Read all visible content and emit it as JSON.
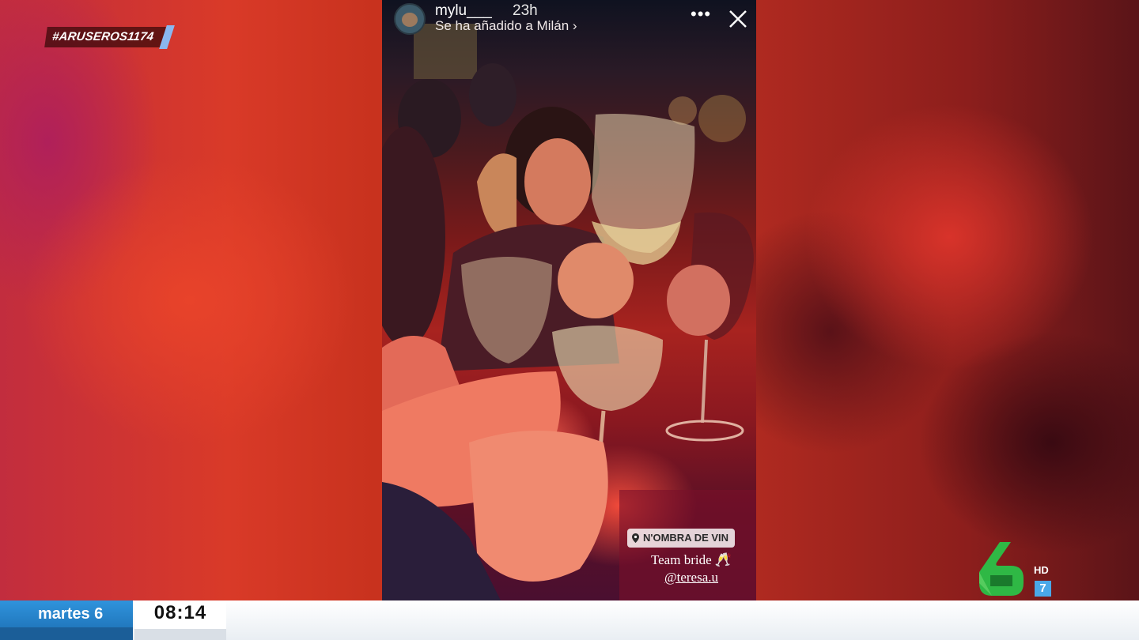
{
  "overlay": {
    "hashtag": "#ARUSEROS1174"
  },
  "story": {
    "username": "mylu___",
    "time": "23h",
    "subtitle": "Se ha añadido a Milán",
    "more_icon": "more-dots-icon",
    "close_icon": "close-icon",
    "location_sticker": "N'OMBRA DE VIN",
    "caption_line1": "Team bride 🥂",
    "caption_mention": "@teresa.u"
  },
  "channel": {
    "hd_label": "HD",
    "seven_label": "7",
    "logo_icon": "la-sexta-logo-icon",
    "logo_color": "#2fb845"
  },
  "ticker": {
    "day": "martes 6",
    "time": "08:14",
    "accent_color": "#1b6cb0"
  }
}
